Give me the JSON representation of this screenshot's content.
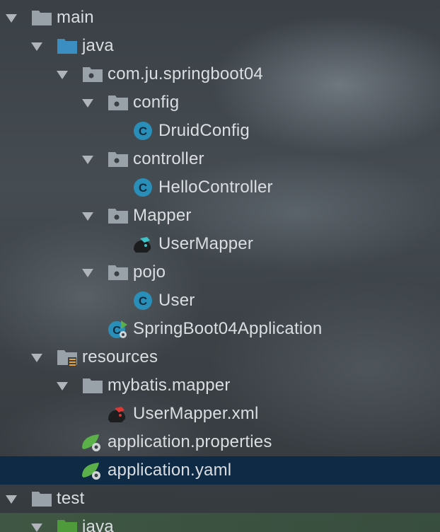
{
  "tree": {
    "nodes": [
      {
        "label": "main",
        "icon": "folder-icon",
        "expanded": true
      },
      {
        "label": "java",
        "icon": "source-folder-icon",
        "expanded": true
      },
      {
        "label": "com.ju.springboot04",
        "icon": "package-icon",
        "expanded": true
      },
      {
        "label": "config",
        "icon": "package-icon",
        "expanded": true
      },
      {
        "label": "DruidConfig",
        "icon": "class-icon"
      },
      {
        "label": "controller",
        "icon": "package-icon",
        "expanded": true
      },
      {
        "label": "HelloController",
        "icon": "class-icon"
      },
      {
        "label": "Mapper",
        "icon": "package-icon",
        "expanded": true
      },
      {
        "label": "UserMapper",
        "icon": "mybatis-interface-icon"
      },
      {
        "label": "pojo",
        "icon": "package-icon",
        "expanded": true
      },
      {
        "label": "User",
        "icon": "class-icon"
      },
      {
        "label": "SpringBoot04Application",
        "icon": "spring-boot-class-icon"
      },
      {
        "label": "resources",
        "icon": "resources-folder-icon",
        "expanded": true
      },
      {
        "label": "mybatis.mapper",
        "icon": "folder-icon",
        "expanded": true
      },
      {
        "label": "UserMapper.xml",
        "icon": "mybatis-xml-icon"
      },
      {
        "label": "application.properties",
        "icon": "spring-config-icon"
      },
      {
        "label": "application.yaml",
        "icon": "spring-config-icon",
        "selected": true
      },
      {
        "label": "test",
        "icon": "folder-icon",
        "expanded": true
      },
      {
        "label": "java",
        "icon": "test-source-folder-icon",
        "expanded": true
      }
    ]
  },
  "colors": {
    "selection": "#0e2a45",
    "class_icon": "#2a8fb8",
    "source_folder": "#3a8ec2",
    "test_folder": "#4f9a3a",
    "spring_green": "#5bb04a"
  }
}
